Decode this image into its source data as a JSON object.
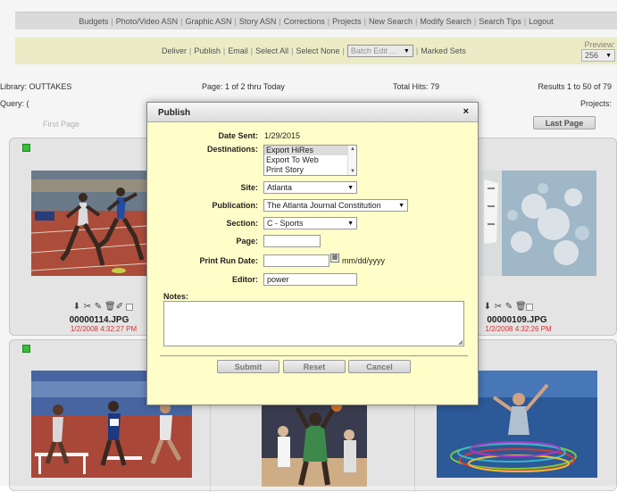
{
  "topnav": [
    "Budgets",
    "Photo/Video ASN",
    "Graphic ASN",
    "Story ASN",
    "Corrections",
    "Projects",
    "New Search",
    "Modify Search",
    "Search Tips",
    "Logout"
  ],
  "actions": {
    "items": [
      "Deliver",
      "Publish",
      "Email",
      "Select All",
      "Select None"
    ],
    "batch_edit": "Batch Edit ...",
    "marked_sets": "Marked Sets",
    "preview_label": "Preview:",
    "preview_value": "256"
  },
  "info": {
    "library": "Library: OUTTAKES",
    "page": "Page: 1 of 2  thru Today",
    "total_hits": "Total Hits: 79",
    "results": "Results 1 to 50 of 79",
    "query": "Query: (",
    "projects": "Projects:",
    "first_page": "First Page",
    "last_page": "Last Page"
  },
  "photos": [
    {
      "file": "00000114.JPG",
      "date": "1/2/2008 4:32:27 PM"
    },
    {
      "file": "00000109.JPG",
      "date": "1/2/2008 4:32:26 PM"
    }
  ],
  "modal": {
    "title": "Publish",
    "close": "×",
    "date_sent_label": "Date Sent:",
    "date_sent": "1/29/2015",
    "destinations_label": "Destinations:",
    "destinations": [
      "Export HiRes",
      "Export To Web",
      "Print Story"
    ],
    "site_label": "Site:",
    "site": "Atlanta",
    "publication_label": "Publication:",
    "publication": "The Atlanta Journal Constitution",
    "section_label": "Section:",
    "section": "C - Sports",
    "page_label": "Page:",
    "page_value": "",
    "print_run_label": "Print Run Date:",
    "print_run_format": "mm/dd/yyyy",
    "editor_label": "Editor:",
    "editor": "power",
    "notes_label": "Notes:",
    "submit": "Submit",
    "reset": "Reset",
    "cancel": "Cancel"
  },
  "colors": {
    "modal_bg": "#fffec9",
    "action_bar": "#f5f5cf",
    "check_green": "#37c837",
    "date_red": "#dd3333"
  }
}
